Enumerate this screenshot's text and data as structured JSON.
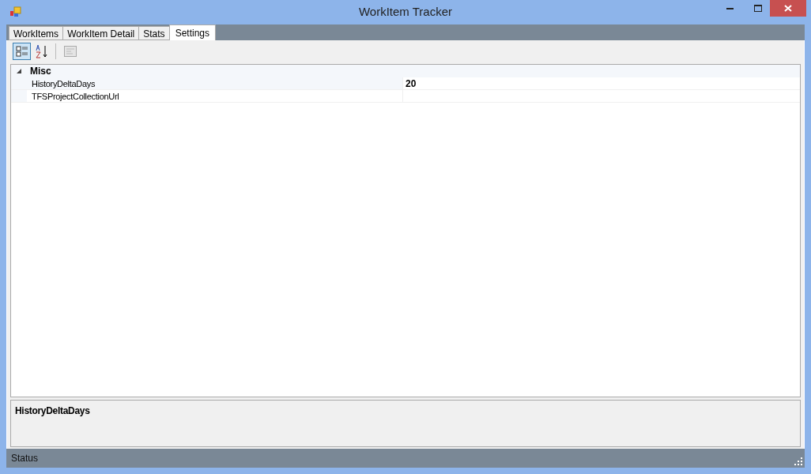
{
  "window": {
    "title": "WorkItem Tracker"
  },
  "tabs": [
    {
      "label": "WorkItems",
      "selected": false
    },
    {
      "label": "WorkItem Detail",
      "selected": false
    },
    {
      "label": "Stats",
      "selected": false
    },
    {
      "label": "Settings",
      "selected": true
    }
  ],
  "toolbar": {
    "categorized": true,
    "alphabetical": false
  },
  "property_grid": {
    "category": {
      "label": "Misc",
      "expanded": true
    },
    "rows": [
      {
        "name": "HistoryDeltaDays",
        "value": "20",
        "selected": true
      },
      {
        "name": "TFSProjectCollectionUrl",
        "selected": false
      }
    ]
  },
  "description": {
    "title": "HistoryDeltaDays"
  },
  "status_bar": "Status"
}
